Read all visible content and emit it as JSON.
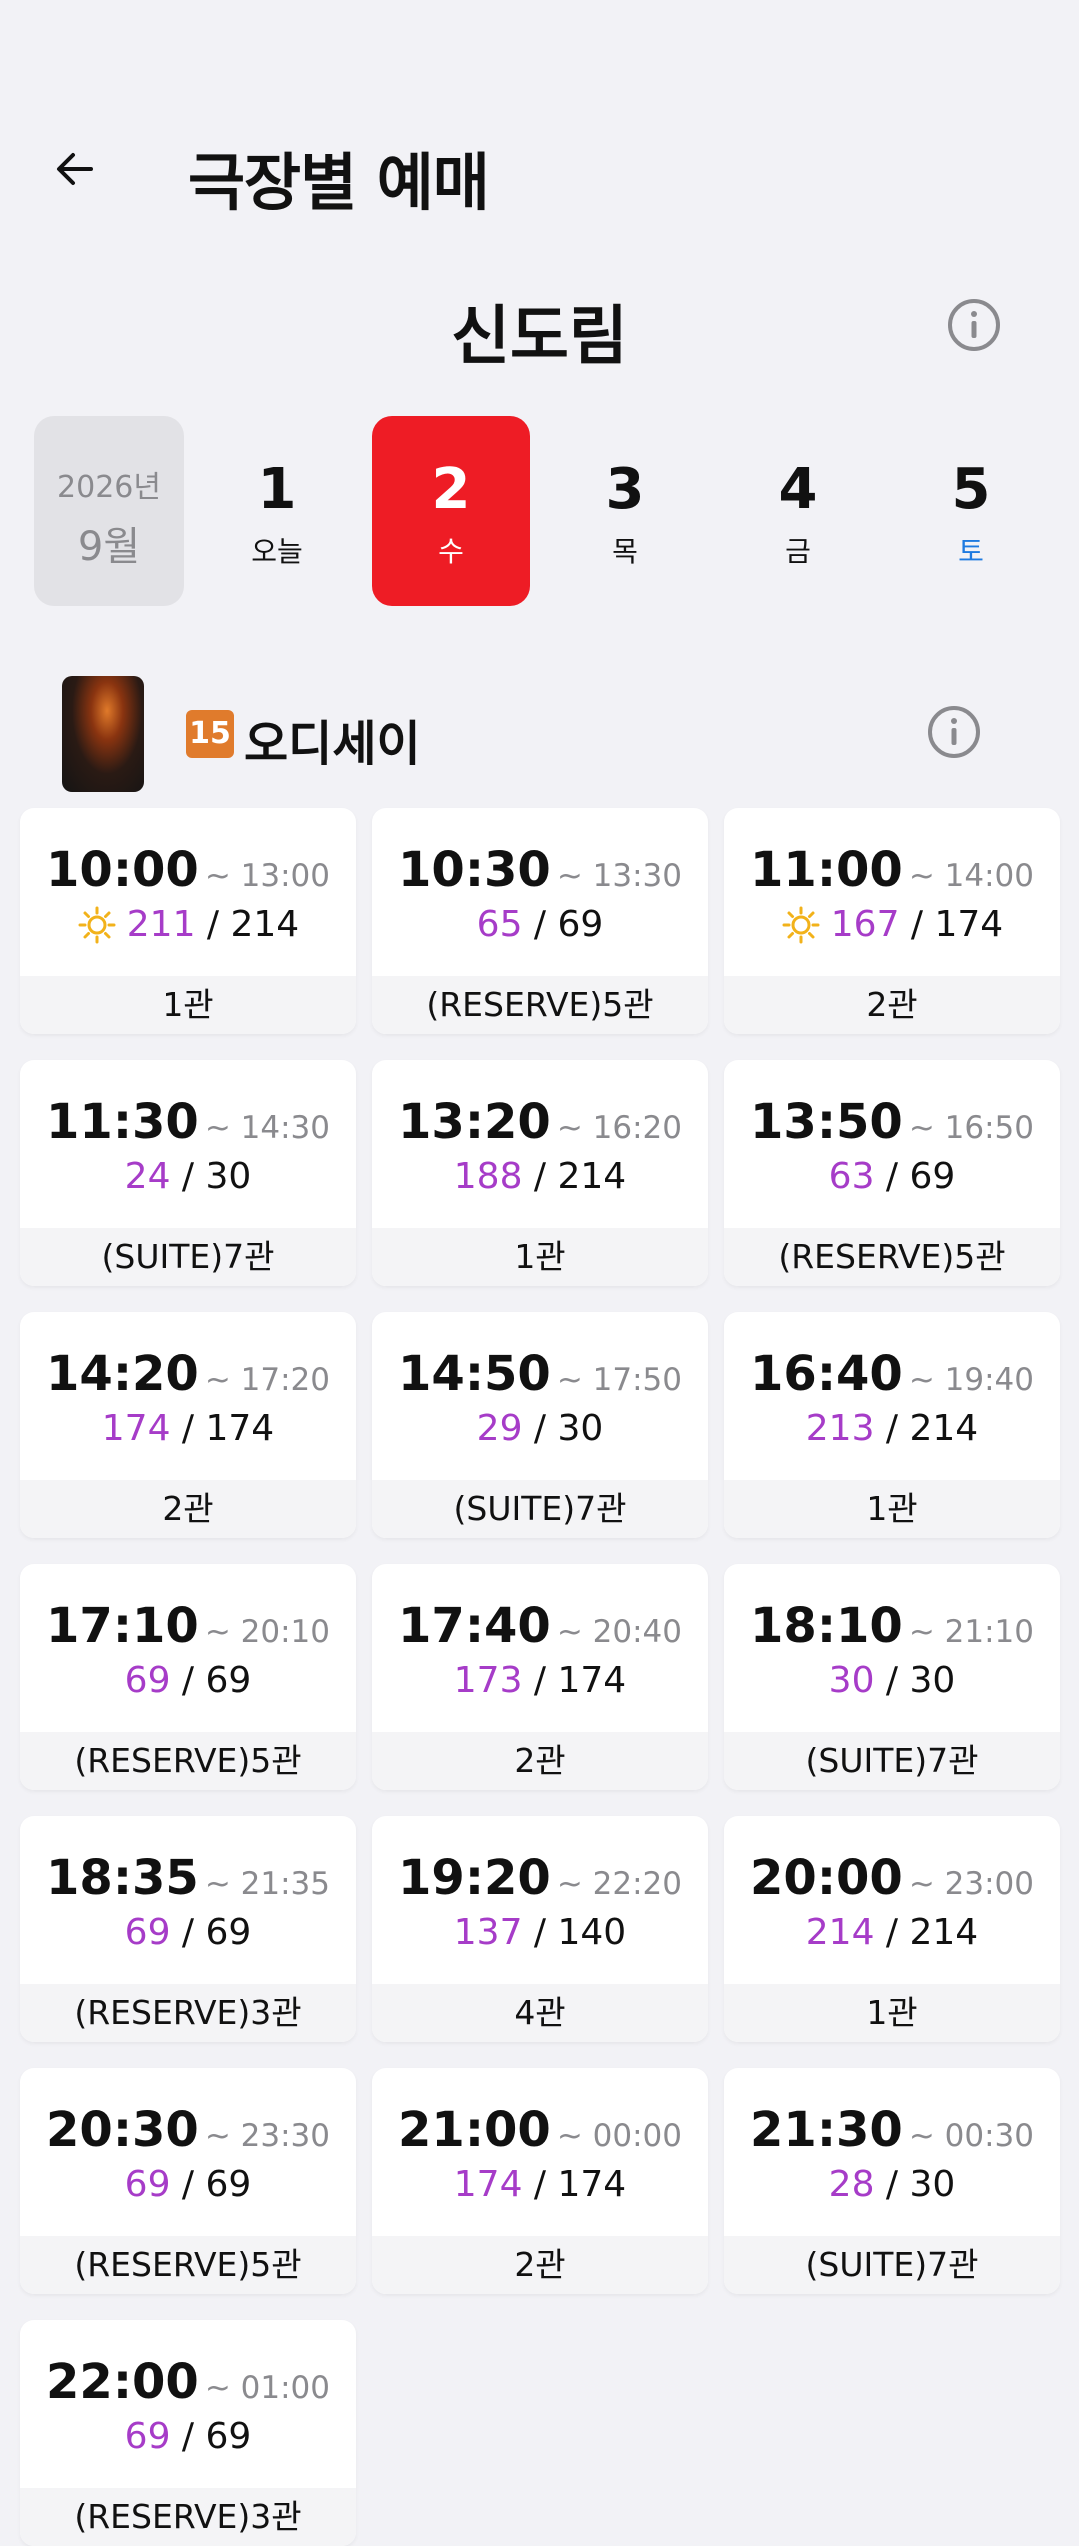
{
  "header": {
    "title": "극장별 예매"
  },
  "theater": {
    "name": "신도림"
  },
  "dates": {
    "year": "2026년",
    "month": "9월",
    "days": [
      {
        "num": "1",
        "dow": "오늘"
      },
      {
        "num": "2",
        "dow": "수"
      },
      {
        "num": "3",
        "dow": "목"
      },
      {
        "num": "4",
        "dow": "금"
      },
      {
        "num": "5",
        "dow": "토"
      }
    ]
  },
  "movie": {
    "rating": "15",
    "title": "오디세이"
  },
  "showtimes": [
    {
      "start": "10:00",
      "end": "~ 13:00",
      "available": "211",
      "total": "214",
      "hall": "1관",
      "morning": true
    },
    {
      "start": "10:30",
      "end": "~ 13:30",
      "available": "65",
      "total": "69",
      "hall": "(RESERVE)5관",
      "morning": false
    },
    {
      "start": "11:00",
      "end": "~ 14:00",
      "available": "167",
      "total": "174",
      "hall": "2관",
      "morning": true
    },
    {
      "start": "11:30",
      "end": "~ 14:30",
      "available": "24",
      "total": "30",
      "hall": "(SUITE)7관",
      "morning": false
    },
    {
      "start": "13:20",
      "end": "~ 16:20",
      "available": "188",
      "total": "214",
      "hall": "1관",
      "morning": false
    },
    {
      "start": "13:50",
      "end": "~ 16:50",
      "available": "63",
      "total": "69",
      "hall": "(RESERVE)5관",
      "morning": false
    },
    {
      "start": "14:20",
      "end": "~ 17:20",
      "available": "174",
      "total": "174",
      "hall": "2관",
      "morning": false
    },
    {
      "start": "14:50",
      "end": "~ 17:50",
      "available": "29",
      "total": "30",
      "hall": "(SUITE)7관",
      "morning": false
    },
    {
      "start": "16:40",
      "end": "~ 19:40",
      "available": "213",
      "total": "214",
      "hall": "1관",
      "morning": false
    },
    {
      "start": "17:10",
      "end": "~ 20:10",
      "available": "69",
      "total": "69",
      "hall": "(RESERVE)5관",
      "morning": false
    },
    {
      "start": "17:40",
      "end": "~ 20:40",
      "available": "173",
      "total": "174",
      "hall": "2관",
      "morning": false
    },
    {
      "start": "18:10",
      "end": "~ 21:10",
      "available": "30",
      "total": "30",
      "hall": "(SUITE)7관",
      "morning": false
    },
    {
      "start": "18:35",
      "end": "~ 21:35",
      "available": "69",
      "total": "69",
      "hall": "(RESERVE)3관",
      "morning": false
    },
    {
      "start": "19:20",
      "end": "~ 22:20",
      "available": "137",
      "total": "140",
      "hall": "4관",
      "morning": false
    },
    {
      "start": "20:00",
      "end": "~ 23:00",
      "available": "214",
      "total": "214",
      "hall": "1관",
      "morning": false
    },
    {
      "start": "20:30",
      "end": "~ 23:30",
      "available": "69",
      "total": "69",
      "hall": "(RESERVE)5관",
      "morning": false
    },
    {
      "start": "21:00",
      "end": "~ 00:00",
      "available": "174",
      "total": "174",
      "hall": "2관",
      "morning": false
    },
    {
      "start": "21:30",
      "end": "~ 00:30",
      "available": "28",
      "total": "30",
      "hall": "(SUITE)7관",
      "morning": false
    },
    {
      "start": "22:00",
      "end": "~ 01:00",
      "available": "69",
      "total": "69",
      "hall": "(RESERVE)3관",
      "morning": false
    }
  ],
  "colors": {
    "accent": "#ee1c25",
    "available": "#a63cc8",
    "saturday": "#1e7ae0",
    "rating": "#e07b2c"
  },
  "icons": {
    "back": "arrow-left-icon",
    "info": "info-circle-icon",
    "morning": "sun-icon"
  }
}
